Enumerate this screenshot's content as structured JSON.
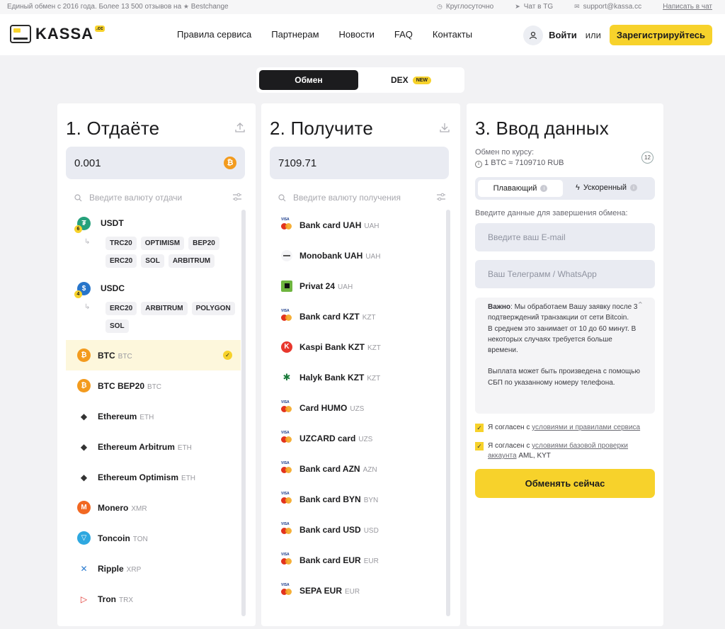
{
  "top_strip": {
    "tagline": "Единый обмен с 2016 года. Более 13 500 отзывов на",
    "bestchange": "Bestchange",
    "hours": "Круглосуточно",
    "chat_tg": "Чат в TG",
    "email": "support@kassa.cc",
    "write_chat": "Написать в чат"
  },
  "header": {
    "logo": "KASSA",
    "logo_cc": ".cc",
    "nav": [
      "Правила сервиса",
      "Партнерам",
      "Новости",
      "FAQ",
      "Контакты"
    ],
    "login": "Войти",
    "or": "или",
    "register": "Зарегистрируйтесь"
  },
  "mode": {
    "exchange": "Обмен",
    "dex": "DEX",
    "dex_badge": "NEW"
  },
  "give": {
    "title": "1. Отдаёте",
    "amount": "0.001",
    "search_placeholder": "Введите валюту отдачи",
    "usdt": {
      "label": "USDT",
      "count": "6",
      "nets": [
        "TRC20",
        "OPTIMISM",
        "BEP20",
        "ERC20",
        "SOL",
        "ARBITRUM"
      ]
    },
    "usdc": {
      "label": "USDC",
      "count": "4",
      "nets": [
        "ERC20",
        "ARBITRUM",
        "POLYGON",
        "SOL"
      ]
    },
    "items": [
      {
        "name": "BTC",
        "ticker": "BTC",
        "color": "#f39b1e",
        "glyph": "₿"
      },
      {
        "name": "BTC BEP20",
        "ticker": "BTC",
        "color": "#f39b1e",
        "glyph": "₿"
      },
      {
        "name": "Ethereum",
        "ticker": "ETH",
        "color": "#ffffff",
        "glyph": "◆"
      },
      {
        "name": "Ethereum Arbitrum",
        "ticker": "ETH",
        "color": "#ffffff",
        "glyph": "◆"
      },
      {
        "name": "Ethereum Optimism",
        "ticker": "ETH",
        "color": "#ffffff",
        "glyph": "◆"
      },
      {
        "name": "Monero",
        "ticker": "XMR",
        "color": "#f26822",
        "glyph": "M"
      },
      {
        "name": "Toncoin",
        "ticker": "TON",
        "color": "#2ea8e0",
        "glyph": "▽"
      },
      {
        "name": "Ripple",
        "ticker": "XRP",
        "color": "#ffffff",
        "glyph": "✕"
      },
      {
        "name": "Tron",
        "ticker": "TRX",
        "color": "#ffffff",
        "glyph": "▷"
      }
    ]
  },
  "receive": {
    "title": "2. Получите",
    "amount": "7109.71",
    "search_placeholder": "Введите валюту получения",
    "items": [
      {
        "name": "Bank card UAH",
        "ticker": "UAH",
        "icon": "card"
      },
      {
        "name": "Monobank UAH",
        "ticker": "UAH",
        "icon": "mono"
      },
      {
        "name": "Privat 24",
        "ticker": "UAH",
        "icon": "privat"
      },
      {
        "name": "Bank card KZT",
        "ticker": "KZT",
        "icon": "card"
      },
      {
        "name": "Kaspi Bank KZT",
        "ticker": "KZT",
        "icon": "kaspi"
      },
      {
        "name": "Halyk Bank KZT",
        "ticker": "KZT",
        "icon": "halyk"
      },
      {
        "name": "Card HUMO",
        "ticker": "UZS",
        "icon": "card"
      },
      {
        "name": "UZCARD card",
        "ticker": "UZS",
        "icon": "card"
      },
      {
        "name": "Bank card AZN",
        "ticker": "AZN",
        "icon": "card"
      },
      {
        "name": "Bank card BYN",
        "ticker": "BYN",
        "icon": "card"
      },
      {
        "name": "Bank card USD",
        "ticker": "USD",
        "icon": "card"
      },
      {
        "name": "Bank card EUR",
        "ticker": "EUR",
        "icon": "card"
      },
      {
        "name": "SEPA EUR",
        "ticker": "EUR",
        "icon": "card"
      }
    ]
  },
  "details": {
    "title": "3. Ввод данных",
    "rate_label": "Обмен по курсу:",
    "rate": "1 BTC ≈ 7109710 RUB",
    "timer": "12",
    "floating": "Плавающий",
    "accelerated": "Ускоренный",
    "intro": "Введите данные для завершения обмена:",
    "email_placeholder": "Введите ваш E-mail",
    "tg_placeholder": "Ваш Телеграмм / WhatsApp",
    "notice_bold": "Важно",
    "notice_p1": ": Мы обработаем Вашу заявку после 3 подтверждений транзакции от сети Bitcoin.",
    "notice_p2": "В среднем это занимает от 10 до 60 минут. В некоторых случаях требуется больше времени.",
    "notice_p3": "Выплата может быть произведена с помощью СБП по указанному номеру телефона.",
    "agree1_pre": "Я согласен с ",
    "agree1_link": "условиями и правилами сервиса",
    "agree2_pre": "Я согласен с ",
    "agree2_link": "условиями базовой проверки аккаунта",
    "agree2_post": " AML, KYT",
    "submit": "Обменять сейчас"
  }
}
